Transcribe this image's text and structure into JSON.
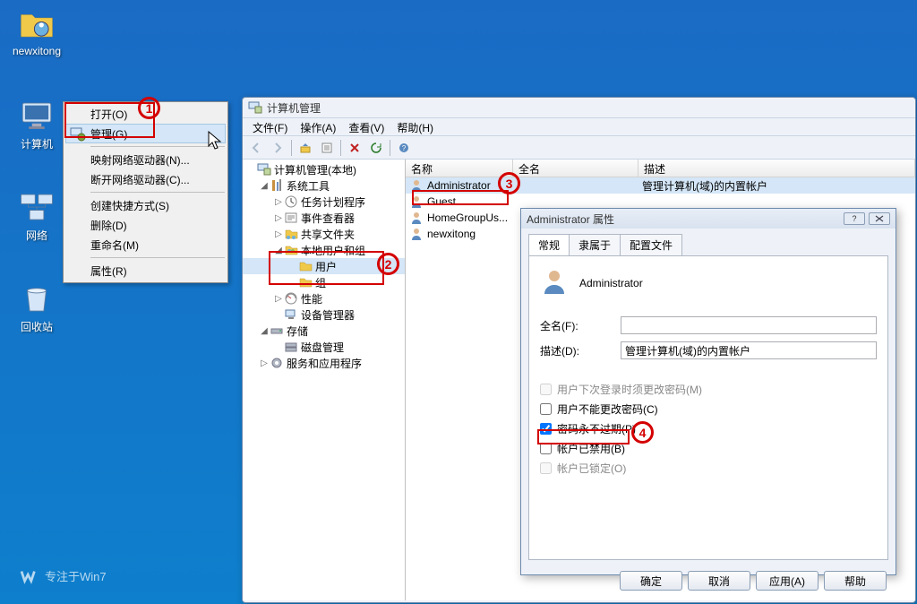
{
  "desktop": {
    "icons": [
      {
        "name": "newxitong"
      },
      {
        "name": "计算机"
      },
      {
        "name": "网络"
      },
      {
        "name": "回收站"
      }
    ],
    "watermark": "专注于Win7"
  },
  "context_menu": {
    "items": [
      {
        "label": "打开(O)"
      },
      {
        "label": "管理(G)",
        "highlight": true
      },
      {
        "sep": true
      },
      {
        "label": "映射网络驱动器(N)..."
      },
      {
        "label": "断开网络驱动器(C)..."
      },
      {
        "sep": true
      },
      {
        "label": "创建快捷方式(S)"
      },
      {
        "label": "删除(D)"
      },
      {
        "label": "重命名(M)"
      },
      {
        "sep": true
      },
      {
        "label": "属性(R)"
      }
    ]
  },
  "mgmt_window": {
    "title": "计算机管理",
    "menus": [
      "文件(F)",
      "操作(A)",
      "查看(V)",
      "帮助(H)"
    ],
    "tree": {
      "root": "计算机管理(本地)",
      "systools": "系统工具",
      "scheduler": "任务计划程序",
      "event": "事件查看器",
      "shared": "共享文件夹",
      "localusers": "本地用户和组",
      "users": "用户",
      "groups": "组",
      "perf": "性能",
      "devmgr": "设备管理器",
      "storage": "存储",
      "diskmgr": "磁盘管理",
      "svcapp": "服务和应用程序"
    },
    "list": {
      "cols": {
        "name": "名称",
        "fullname": "全名",
        "desc": "描述"
      },
      "rows": [
        {
          "name": "Administrator",
          "desc": "管理计算机(域)的内置帐户"
        },
        {
          "name": "Guest"
        },
        {
          "name": "HomeGroupUs..."
        },
        {
          "name": "newxitong"
        }
      ]
    }
  },
  "props_dialog": {
    "title": "Administrator 属性",
    "tabs": [
      "常规",
      "隶属于",
      "配置文件"
    ],
    "username": "Administrator",
    "fields": {
      "fullname_label": "全名(F):",
      "fullname_value": "",
      "desc_label": "描述(D):",
      "desc_value": "管理计算机(域)的内置帐户"
    },
    "checks": {
      "mustchange": "用户下次登录时须更改密码(M)",
      "cannotchange": "用户不能更改密码(C)",
      "neverexpire": "密码永不过期(P)",
      "disabled": "帐户已禁用(B)",
      "locked": "帐户已锁定(O)"
    },
    "buttons": {
      "ok": "确定",
      "cancel": "取消",
      "apply": "应用(A)",
      "help": "帮助"
    }
  },
  "annotations": [
    "1",
    "2",
    "3",
    "4"
  ]
}
